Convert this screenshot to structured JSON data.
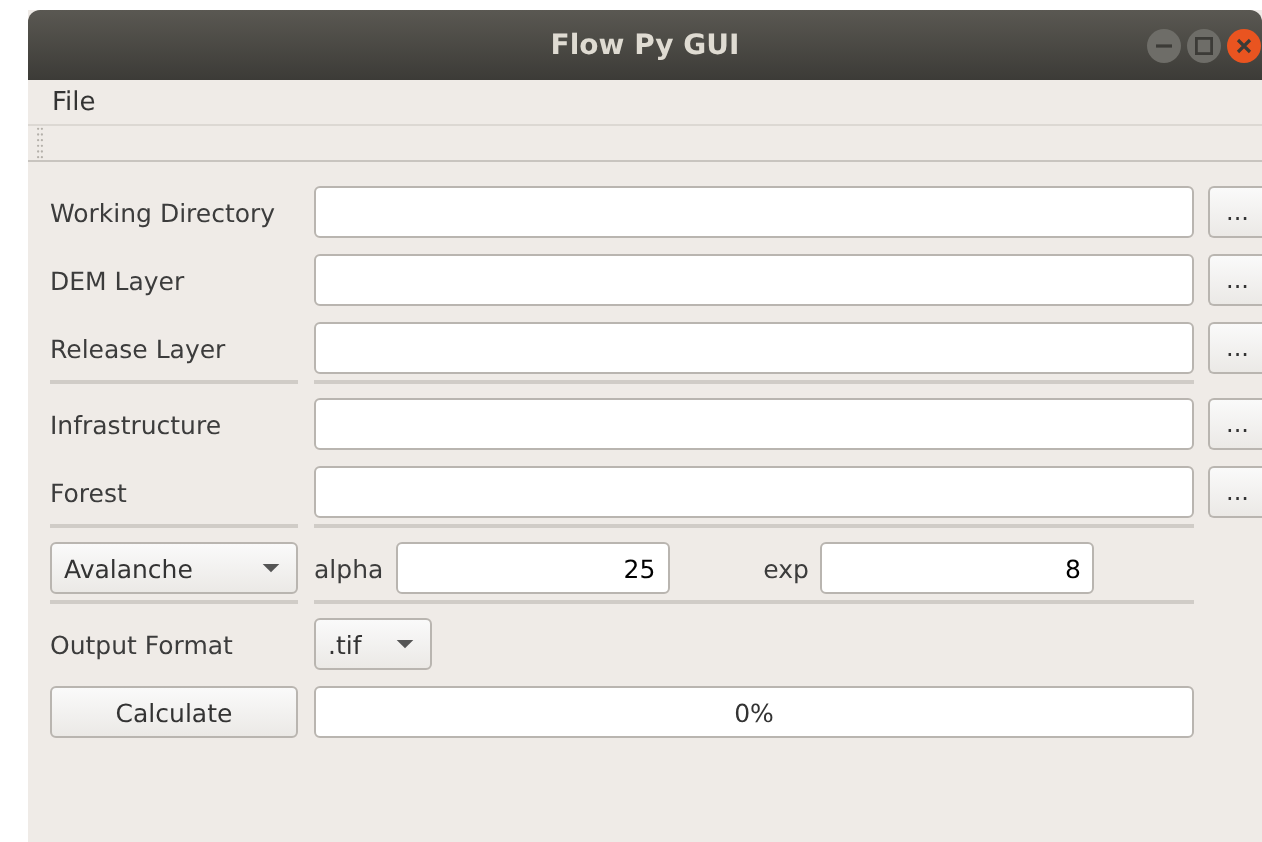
{
  "window": {
    "title": "Flow Py GUI"
  },
  "menu": [
    "File"
  ],
  "input_groups": [
    [
      {
        "label": "Working Directory",
        "browse": "..."
      },
      {
        "label": "DEM Layer",
        "browse": "..."
      },
      {
        "label": "Release Layer",
        "browse": "..."
      }
    ],
    [
      {
        "label": "Infrastructure",
        "browse": "..."
      },
      {
        "label": "Forest",
        "browse": "..."
      }
    ]
  ],
  "process": {
    "value": "Avalanche"
  },
  "alpha": {
    "label": "alpha",
    "value": "25"
  },
  "exp": {
    "label": "exp",
    "value": "8"
  },
  "output_format": {
    "label": "Output Format",
    "value": ".tif"
  },
  "calculate_button": "Calculate",
  "progress": {
    "level": 0,
    "text": "0%"
  }
}
